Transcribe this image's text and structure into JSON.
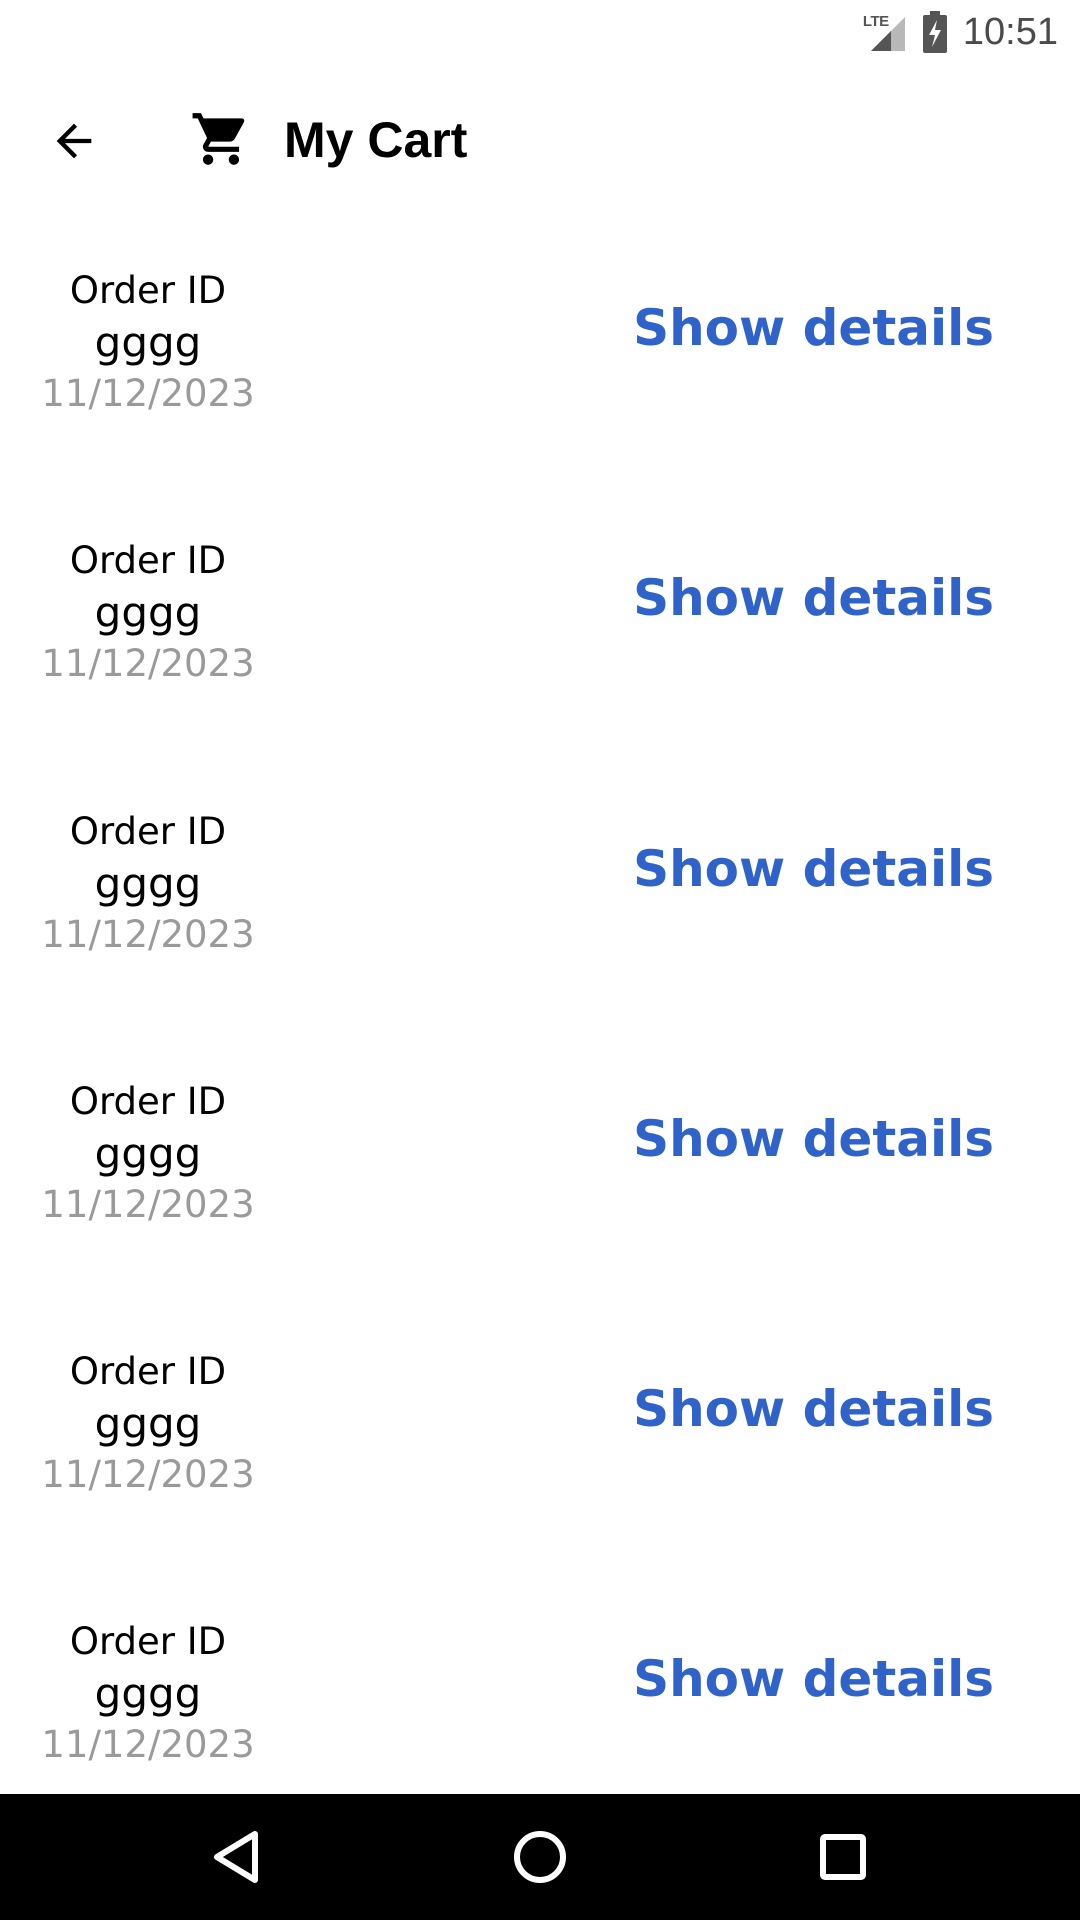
{
  "status_bar": {
    "network_label": "LTE",
    "time": "10:51",
    "signal_icon": "signal-icon",
    "battery_icon": "battery-charging-icon"
  },
  "app_bar": {
    "back_icon": "arrow-left-icon",
    "cart_icon": "cart-icon",
    "title": "My Cart"
  },
  "orders": [
    {
      "label": "Order ID",
      "id": "gggg",
      "date": "11/12/2023",
      "action": "Show details"
    },
    {
      "label": "Order ID",
      "id": "gggg",
      "date": "11/12/2023",
      "action": "Show details"
    },
    {
      "label": "Order ID",
      "id": "gggg",
      "date": "11/12/2023",
      "action": "Show details"
    },
    {
      "label": "Order ID",
      "id": "gggg",
      "date": "11/12/2023",
      "action": "Show details"
    },
    {
      "label": "Order ID",
      "id": "gggg",
      "date": "11/12/2023",
      "action": "Show details"
    },
    {
      "label": "Order ID",
      "id": "gggg",
      "date": "11/12/2023",
      "action": "Show details"
    }
  ],
  "nav_bar": {
    "back_icon": "nav-back-icon",
    "home_icon": "nav-home-icon",
    "recents_icon": "nav-recents-icon"
  },
  "colors": {
    "accent": "#2f63c9",
    "date_text": "#9a9a9a",
    "nav_background": "#000000"
  }
}
